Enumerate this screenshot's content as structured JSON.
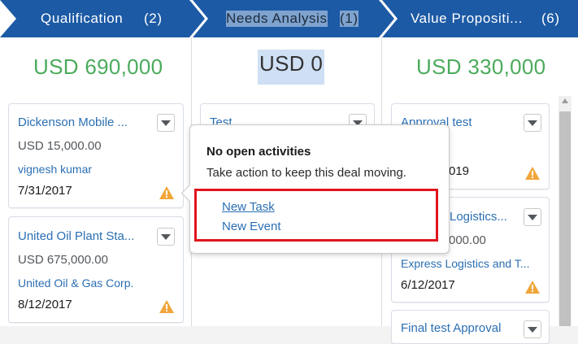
{
  "stages": [
    {
      "label": "Qualification",
      "count": "(2)"
    },
    {
      "label": "Needs Analysis",
      "count": "(1)"
    },
    {
      "label": "Value Propositi...",
      "count": "(6)"
    }
  ],
  "totals": [
    "USD 690,000",
    "USD 0",
    "USD 330,000"
  ],
  "cards": {
    "qual_1": {
      "title": "Dickenson Mobile ...",
      "amount": "USD 15,000.00",
      "account": "vignesh kumar",
      "date": "7/31/2017"
    },
    "qual_2": {
      "title": "United Oil Plant Sta...",
      "amount": "USD 675,000.00",
      "account": "United Oil & Gas Corp.",
      "date": "8/12/2017"
    },
    "needs_1": {
      "title": "Test"
    },
    "value_1": {
      "title": "Approval test",
      "date_partial": "019"
    },
    "value_2": {
      "title_partial": "Logistics...",
      "amount_partial": "000.00",
      "account": "Express Logistics and T...",
      "date": "6/12/2017"
    },
    "value_3": {
      "title_partial": "Final test Approval"
    }
  },
  "popover": {
    "title": "No open activities",
    "message": "Take action to keep this deal moving.",
    "links": [
      "New Task",
      "New Event"
    ]
  },
  "colors": {
    "stage_bar": "#1c5aa5",
    "highlight_box": "#e0151d",
    "amount_green": "#4bab5c",
    "link_blue": "#2b6fb3"
  }
}
